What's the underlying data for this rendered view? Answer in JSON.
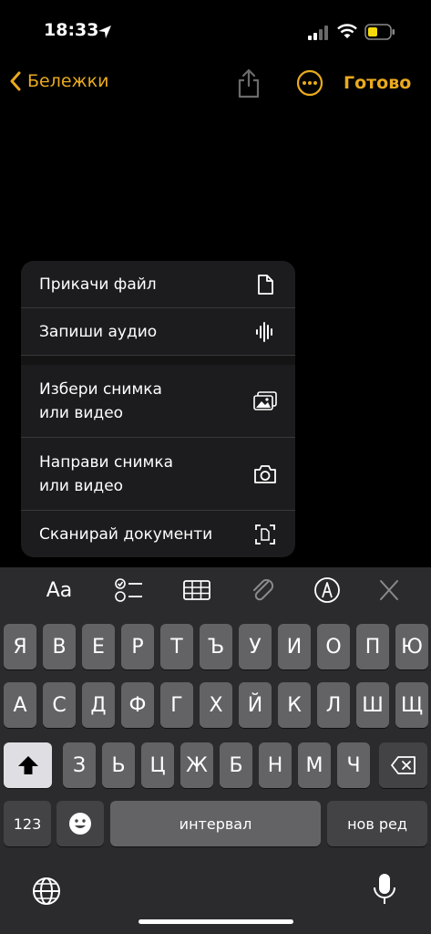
{
  "status": {
    "time": "18:33"
  },
  "nav": {
    "back_label": "Бележки",
    "done_label": "Готово"
  },
  "menu": {
    "items": [
      {
        "label": "Прикачи файл",
        "icon": "document-icon"
      },
      {
        "label": "Запиши аудио",
        "icon": "waveform-icon"
      },
      {
        "label": "Избери снимка\nили видео",
        "icon": "photo-icon"
      },
      {
        "label": "Направи снимка\nили видео",
        "icon": "camera-icon"
      },
      {
        "label": "Сканирай документи",
        "icon": "scan-icon"
      }
    ]
  },
  "toolbar": {
    "format_label": "Aa"
  },
  "keyboard": {
    "row1": [
      "Я",
      "В",
      "Е",
      "Р",
      "Т",
      "Ъ",
      "У",
      "И",
      "О",
      "П",
      "Ю"
    ],
    "row2": [
      "А",
      "С",
      "Д",
      "Ф",
      "Г",
      "Х",
      "Й",
      "К",
      "Л",
      "Ш",
      "Щ"
    ],
    "row3": [
      "З",
      "Ь",
      "Ц",
      "Ж",
      "Б",
      "Н",
      "М",
      "Ч"
    ],
    "numbers_label": "123",
    "space_label": "интервал",
    "return_label": "нов ред"
  },
  "colors": {
    "accent": "#e9aa1e",
    "key": "#636366",
    "key_dark": "#434345",
    "menu_bg": "#1c1c1e"
  }
}
